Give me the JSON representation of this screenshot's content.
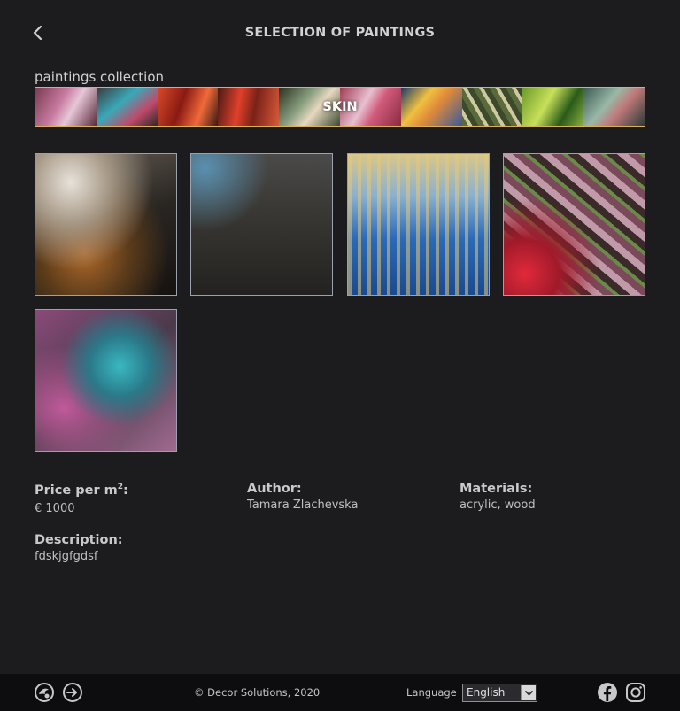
{
  "header": {
    "title": "SELECTION OF PAINTINGS"
  },
  "collection": {
    "label": "paintings collection",
    "selected_name": "SKIN",
    "accent_color": "#d9b15c"
  },
  "details": {
    "price_label": "Price per m",
    "price_sup": "2",
    "price_suffix": ":",
    "price_value": "€ 1000",
    "author_label": "Author:",
    "author_value": "Tamara Zlachevska",
    "materials_label": "Materials:",
    "materials_value": "acrylic, wood",
    "description_label": "Description:",
    "description_value": "fdskjgfgdsf"
  },
  "footer": {
    "copyright": "© Decor Solutions, 2020",
    "language_label": "Language",
    "language_value": "English",
    "icons": [
      "globe-logo-icon",
      "login-icon",
      "facebook-icon",
      "instagram-icon"
    ]
  }
}
